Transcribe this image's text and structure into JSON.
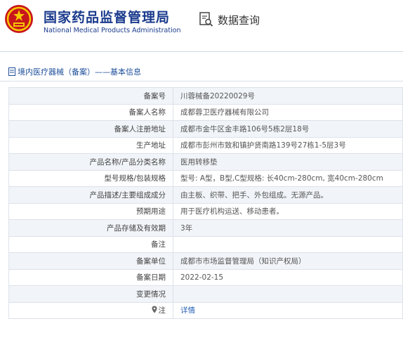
{
  "header": {
    "title_cn": "国家药品监督管理局",
    "title_en": "National Medical Products Administration",
    "query_label": "数据查询"
  },
  "breadcrumb": {
    "text": "境内医疗器械（备案）——基本信息"
  },
  "rows": [
    {
      "label": "备案号",
      "value": "川蓉械备20220029号"
    },
    {
      "label": "备案人名称",
      "value": "成都蓉卫医疗器械有限公司"
    },
    {
      "label": "备案人注册地址",
      "value": "成都市金牛区金丰路106号5栋2层18号"
    },
    {
      "label": "生产地址",
      "value": "成都市彭州市致和镇护贤南路139号27栋1-5层3号"
    },
    {
      "label": "产品名称/产品分类名称",
      "value": "医用转移垫"
    },
    {
      "label": "型号规格/包装规格",
      "value": "型号: A型，B型,C型规格: 长40cm-280cm, 宽40cm-280cm"
    },
    {
      "label": "产品描述/主要组成成分",
      "value": "由主板、织带、把手、外包组成。无源产品。"
    },
    {
      "label": "预期用途",
      "value": "用于医疗机构运送、移动患者。"
    },
    {
      "label": "产品存储及有效期",
      "value": "3年"
    },
    {
      "label": "备注",
      "value": ""
    },
    {
      "label": "备案单位",
      "value": "成都市市场监督管理局（知识产权局）"
    },
    {
      "label": "备案日期",
      "value": "2022-02-15"
    },
    {
      "label": "变更情况",
      "value": ""
    },
    {
      "label": "注",
      "value": "详情"
    }
  ],
  "colors": {
    "brand": "#1a3a8c",
    "link": "#2b64b8",
    "alt_row": "#f1f4f8"
  },
  "icons": {
    "emblem": "national-emblem-icon",
    "query": "search-document-icon",
    "breadcrumb": "document-icon",
    "note": "location-pin-icon"
  }
}
